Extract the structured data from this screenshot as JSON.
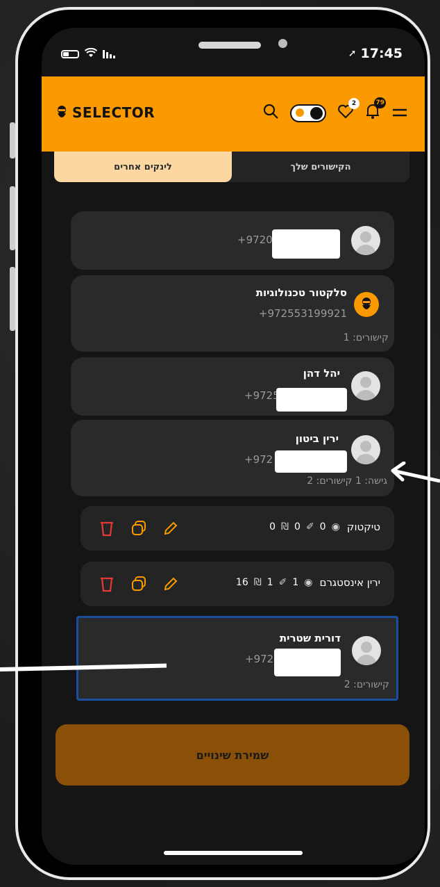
{
  "status_bar": {
    "time": "17:45"
  },
  "header": {
    "logo_text": "SELECTOR",
    "likes_badge": "2",
    "notifications_badge": "79"
  },
  "tabs": {
    "active_label": "לינקים אחרים",
    "inactive_label": "הקישורים שלך"
  },
  "contacts": [
    {
      "phone": "+9720"
    },
    {
      "name": "סלקטור טכנולוגיות",
      "phone": "+972553199921",
      "meta": "קישורים: 1"
    },
    {
      "name": "יהל דהן",
      "phone": "+9725"
    },
    {
      "name": "ירין ביטון",
      "phone": "+972",
      "meta": "גישה: 1  קישורים: 2"
    },
    {
      "name": "דורית שטרית",
      "phone": "+972",
      "meta": "קישורים: 2"
    }
  ],
  "links": [
    {
      "title": "טיקטוק",
      "views": "0",
      "clicks": "0",
      "revenue": "0",
      "currency": "₪"
    },
    {
      "title": "ירין אינסטגרם",
      "views": "1",
      "clicks": "1",
      "revenue": "16",
      "currency": "₪"
    }
  ],
  "save_button": {
    "label": "שמירת שינויים"
  },
  "colors": {
    "accent": "#fb9a00",
    "save_bg": "#8a5008",
    "selected_border": "#1a4fa0",
    "delete": "#e53935"
  }
}
